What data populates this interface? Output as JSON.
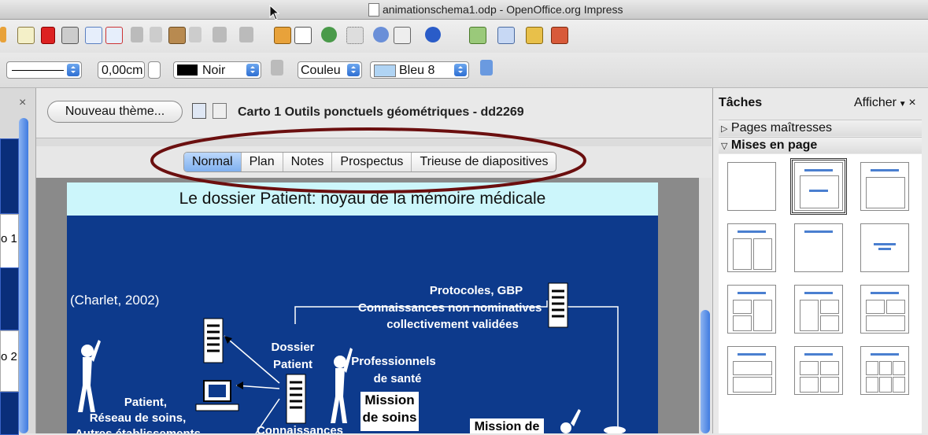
{
  "window": {
    "title": "animationschema1.odp - OpenOffice.org Impress"
  },
  "toolbar2": {
    "line_width": "0,00cm",
    "line_color": "Noir",
    "area_style": "Couleu",
    "area_color": "Bleu 8"
  },
  "left_panel": {
    "slide_labels": [
      "o 1",
      "o 2"
    ]
  },
  "center": {
    "new_theme_button": "Nouveau thème...",
    "slide_name": "Carto 1 Outils ponctuels géométriques - dd2269",
    "tabs": [
      "Normal",
      "Plan",
      "Notes",
      "Prospectus",
      "Trieuse de diapositives"
    ],
    "active_tab": "Normal"
  },
  "slide": {
    "title": "Le dossier Patient: noyau de la mémoire médicale",
    "citation": "(Charlet, 2002)",
    "protocoles": "Protocoles, GBP",
    "connaissances_nn": "Connaissances non nominatives",
    "collectivement": "collectivement validées",
    "dossier": "Dossier",
    "patient": "Patient",
    "professionnels": "Professionnels",
    "de_sante": "de santé",
    "mission": "Mission",
    "de_soins": "de soins",
    "patient_label": "Patient,",
    "reseau": "Réseau de soins,",
    "autres": "Autres établissements",
    "connaissances_cut": "Connaissances",
    "mission_de": "Mission de"
  },
  "tasks_panel": {
    "title": "Tâches",
    "view_menu": "Afficher",
    "sections": [
      "Pages maîtresses",
      "Mises en page"
    ]
  },
  "colors": {
    "slide_bg": "#0d3a8c",
    "slide_title_bg": "#ccf6fb",
    "highlight_ellipse": "#6b0f0f",
    "active_tab": "#8db9f2"
  },
  "icons": [
    "cursor-icon",
    "document-icon",
    "edit-icon",
    "pdf-icon",
    "print-icon",
    "spellcheck-icon",
    "cut-icon",
    "copy-icon",
    "paste-icon",
    "undo-icon",
    "redo-icon",
    "chart-icon",
    "table-icon",
    "navigator-icon",
    "zoom-icon",
    "help-icon"
  ]
}
